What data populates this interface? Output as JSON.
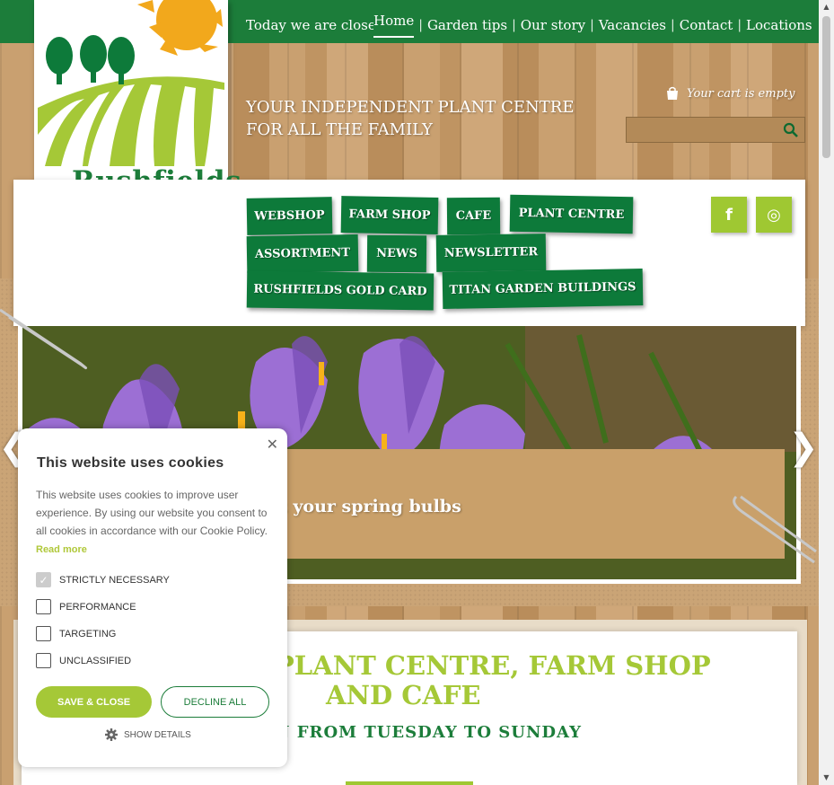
{
  "topnav": {
    "ticker": "Today we are close",
    "items": [
      "Home",
      "Garden tips",
      "Our story",
      "Vacancies",
      "Contact",
      "Locations"
    ],
    "separator": "|"
  },
  "logo": {
    "text": "Rushfields"
  },
  "tagline": {
    "line1": "YOUR INDEPENDENT PLANT CENTRE",
    "line2": "FOR ALL THE FAMILY"
  },
  "cart": {
    "label": "Your cart is empty"
  },
  "search": {
    "placeholder": ""
  },
  "menu": {
    "row1": [
      "WEBSHOP",
      "FARM SHOP",
      "CAFE",
      "PLANT CENTRE"
    ],
    "row2": [
      "ASSORTMENT",
      "NEWS",
      "NEWSLETTER"
    ],
    "row3": [
      "RUSHFIELDS GOLD CARD",
      "TITAN GARDEN BUILDINGS"
    ]
  },
  "social": {
    "facebook": "f",
    "instagram": "◎"
  },
  "banner": {
    "caption": "t your spring bulbs",
    "prev": "❮",
    "next": "❯"
  },
  "content": {
    "headline_line1": "PLANT CENTRE, FARM SHOP",
    "headline_line2": "AND CAFE",
    "subline": "N FROM TUESDAY TO SUNDAY"
  },
  "cookie": {
    "title": "This website uses cookies",
    "close": "✕",
    "body": "This website uses cookies to improve user experience. By using our website you consent to all cookies in accordance with our Cookie Policy.",
    "read_more": "Read more",
    "options": [
      {
        "label": "STRICTLY NECESSARY",
        "checked": true
      },
      {
        "label": "PERFORMANCE",
        "checked": false
      },
      {
        "label": "TARGETING",
        "checked": false
      },
      {
        "label": "UNCLASSIFIED",
        "checked": false
      }
    ],
    "save": "SAVE & CLOSE",
    "decline": "DECLINE ALL",
    "show_details": "SHOW DETAILS"
  },
  "colors": {
    "brand_green": "#1c7d3a",
    "lime": "#a5c837",
    "wood": "#c9a070"
  }
}
